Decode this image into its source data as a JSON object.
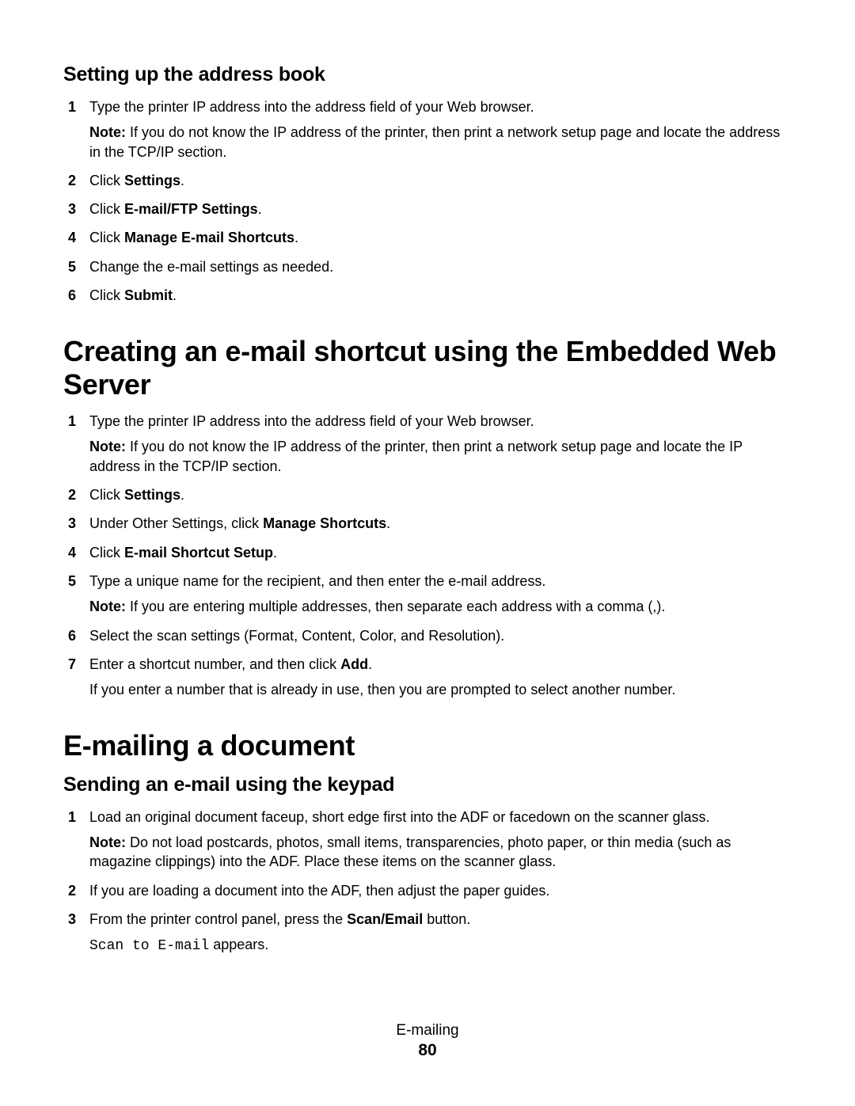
{
  "footer": {
    "section": "E-mailing",
    "page": "80"
  },
  "noteLabel": "Note:",
  "sec1": {
    "heading": "Setting up the address book",
    "steps": [
      {
        "num": "1",
        "text": "Type the printer IP address into the address field of your Web browser.",
        "note": "If you do not know the IP address of the printer, then print a network setup page and locate the address in the TCP/IP section."
      },
      {
        "num": "2",
        "pre": "Click ",
        "bold": "Settings",
        "post": "."
      },
      {
        "num": "3",
        "pre": "Click ",
        "bold": "E-mail/FTP Settings",
        "post": "."
      },
      {
        "num": "4",
        "pre": "Click ",
        "bold": "Manage E-mail Shortcuts",
        "post": "."
      },
      {
        "num": "5",
        "text": "Change the e-mail settings as needed."
      },
      {
        "num": "6",
        "pre": "Click ",
        "bold": "Submit",
        "post": "."
      }
    ]
  },
  "sec2": {
    "heading": "Creating an e-mail shortcut using the Embedded Web Server",
    "steps": [
      {
        "num": "1",
        "text": "Type the printer IP address into the address field of your Web browser.",
        "note": "If you do not know the IP address of the printer, then print a network setup page and locate the IP address in the TCP/IP section."
      },
      {
        "num": "2",
        "pre": "Click ",
        "bold": "Settings",
        "post": "."
      },
      {
        "num": "3",
        "pre": "Under Other Settings, click ",
        "bold": "Manage Shortcuts",
        "post": "."
      },
      {
        "num": "4",
        "pre": "Click ",
        "bold": "E-mail Shortcut Setup",
        "post": "."
      },
      {
        "num": "5",
        "text": "Type a unique name for the recipient, and then enter the e-mail address.",
        "note": "If you are entering multiple addresses, then separate each address with a comma (,)."
      },
      {
        "num": "6",
        "text": "Select the scan settings (Format, Content, Color, and Resolution)."
      },
      {
        "num": "7",
        "pre": "Enter a shortcut number, and then click ",
        "bold": "Add",
        "post": ".",
        "sub": "If you enter a number that is already in use, then you are prompted to select another number."
      }
    ]
  },
  "sec3": {
    "heading": "E-mailing a document",
    "subheading": "Sending an e-mail using the keypad",
    "steps": [
      {
        "num": "1",
        "text": "Load an original document faceup, short edge first into the ADF or facedown on the scanner glass.",
        "note": "Do not load postcards, photos, small items, transparencies, photo paper, or thin media (such as magazine clippings) into the ADF. Place these items on the scanner glass."
      },
      {
        "num": "2",
        "text": "If you are loading a document into the ADF, then adjust the paper guides."
      },
      {
        "num": "3",
        "pre": "From the printer control panel, press the ",
        "bold": "Scan/Email",
        "post": " button.",
        "mono": "Scan to E-mail",
        "monoPost": " appears."
      }
    ]
  }
}
